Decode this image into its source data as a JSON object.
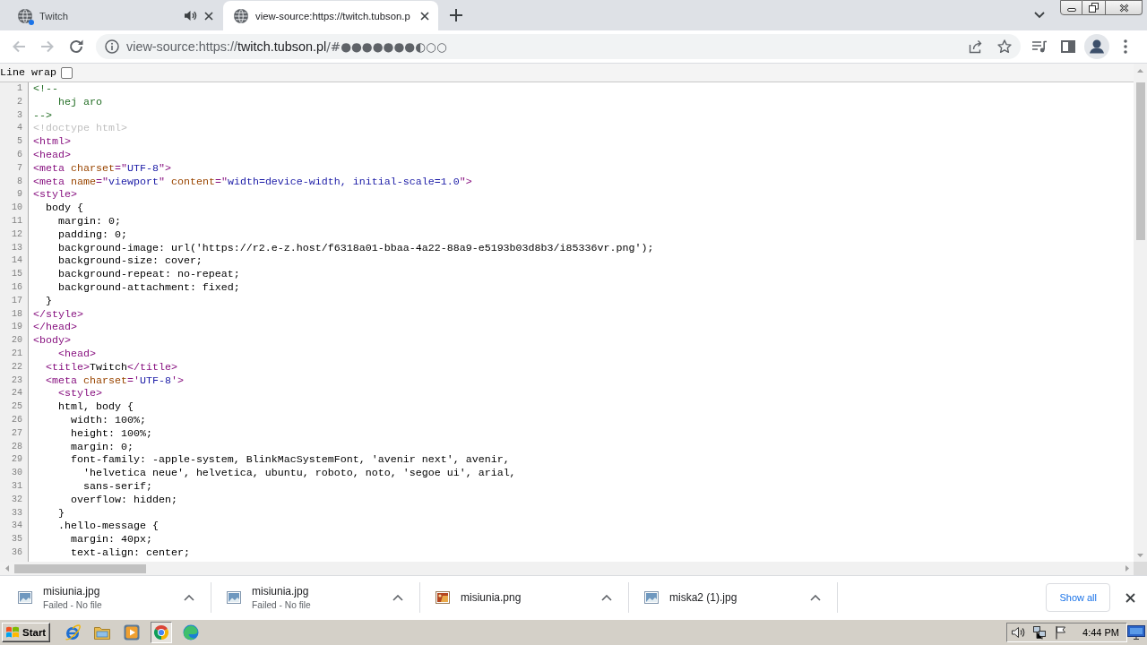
{
  "tabs": [
    {
      "title": "Twitch",
      "selected": false,
      "attention": true,
      "audio": true
    },
    {
      "title": "view-source:https://twitch.tubson.p",
      "selected": true,
      "attention": false,
      "audio": false
    }
  ],
  "toolbar": {
    "nav_buttons": [
      {
        "kind": "back",
        "disabled": true
      },
      {
        "kind": "forward",
        "disabled": true
      },
      {
        "kind": "reload",
        "disabled": false
      }
    ],
    "address": {
      "scheme": "view-source:https://",
      "host": "twitch.tubson.pl",
      "path": "/#●●●●●●●◐○○"
    }
  },
  "source_view": {
    "line_wrap": {
      "label": "Line wrap",
      "checked": false
    },
    "lines": [
      {
        "number": "1",
        "tokens": [
          {
            "kind": "comment",
            "text": "<!--"
          }
        ]
      },
      {
        "number": "2",
        "tokens": [
          {
            "kind": "comment",
            "text": "    hej aro"
          }
        ]
      },
      {
        "number": "3",
        "tokens": [
          {
            "kind": "comment",
            "text": "-->"
          }
        ]
      },
      {
        "number": "4",
        "tokens": [
          {
            "kind": "doctype",
            "text": "<!doctype html>"
          }
        ]
      },
      {
        "number": "5",
        "tokens": [
          {
            "kind": "tag",
            "text": "<html>"
          }
        ]
      },
      {
        "number": "6",
        "tokens": [
          {
            "kind": "tag",
            "text": "<head>"
          }
        ]
      },
      {
        "number": "7",
        "tokens": [
          {
            "kind": "tag",
            "text": "<meta "
          },
          {
            "kind": "attribute",
            "text": "charset"
          },
          {
            "kind": "tag",
            "text": "=\""
          },
          {
            "kind": "value",
            "text": "UTF-8"
          },
          {
            "kind": "tag",
            "text": "\">"
          }
        ]
      },
      {
        "number": "8",
        "tokens": [
          {
            "kind": "tag",
            "text": "<meta "
          },
          {
            "kind": "attribute",
            "text": "name"
          },
          {
            "kind": "tag",
            "text": "=\""
          },
          {
            "kind": "value",
            "text": "viewport"
          },
          {
            "kind": "tag",
            "text": "\" "
          },
          {
            "kind": "attribute",
            "text": "content"
          },
          {
            "kind": "tag",
            "text": "=\""
          },
          {
            "kind": "value",
            "text": "width=device-width, initial-scale=1.0"
          },
          {
            "kind": "tag",
            "text": "\">"
          }
        ]
      },
      {
        "number": "9",
        "tokens": [
          {
            "kind": "tag",
            "text": "<style>"
          }
        ]
      },
      {
        "number": "10",
        "tokens": [
          {
            "kind": "text",
            "text": "  body {"
          }
        ]
      },
      {
        "number": "11",
        "tokens": [
          {
            "kind": "text",
            "text": "    margin: 0;"
          }
        ]
      },
      {
        "number": "12",
        "tokens": [
          {
            "kind": "text",
            "text": "    padding: 0;"
          }
        ]
      },
      {
        "number": "13",
        "tokens": [
          {
            "kind": "text",
            "text": "    background-image: url('https://r2.e-z.host/f6318a01-bbaa-4a22-88a9-e5193b03d8b3/i85336vr.png');"
          }
        ]
      },
      {
        "number": "14",
        "tokens": [
          {
            "kind": "text",
            "text": "    background-size: cover;"
          }
        ]
      },
      {
        "number": "15",
        "tokens": [
          {
            "kind": "text",
            "text": "    background-repeat: no-repeat;"
          }
        ]
      },
      {
        "number": "16",
        "tokens": [
          {
            "kind": "text",
            "text": "    background-attachment: fixed;"
          }
        ]
      },
      {
        "number": "17",
        "tokens": [
          {
            "kind": "text",
            "text": "  }"
          }
        ]
      },
      {
        "number": "18",
        "tokens": [
          {
            "kind": "tag",
            "text": "</style>"
          }
        ]
      },
      {
        "number": "19",
        "tokens": [
          {
            "kind": "tag",
            "text": "</head>"
          }
        ]
      },
      {
        "number": "20",
        "tokens": [
          {
            "kind": "tag",
            "text": "<body>"
          }
        ]
      },
      {
        "number": "21",
        "tokens": [
          {
            "kind": "tag",
            "text": "    <head>"
          }
        ]
      },
      {
        "number": "22",
        "tokens": [
          {
            "kind": "tag",
            "text": "  <title>"
          },
          {
            "kind": "text",
            "text": "Twitch"
          },
          {
            "kind": "tag",
            "text": "</title>"
          }
        ]
      },
      {
        "number": "23",
        "tokens": [
          {
            "kind": "tag",
            "text": "  <meta "
          },
          {
            "kind": "attribute",
            "text": "charset"
          },
          {
            "kind": "tag",
            "text": "='"
          },
          {
            "kind": "value",
            "text": "UTF-8"
          },
          {
            "kind": "tag",
            "text": "'>"
          }
        ]
      },
      {
        "number": "24",
        "tokens": [
          {
            "kind": "tag",
            "text": "    <style>"
          }
        ]
      },
      {
        "number": "25",
        "tokens": [
          {
            "kind": "text",
            "text": "    html, body {"
          }
        ]
      },
      {
        "number": "26",
        "tokens": [
          {
            "kind": "text",
            "text": "      width: 100%;"
          }
        ]
      },
      {
        "number": "27",
        "tokens": [
          {
            "kind": "text",
            "text": "      height: 100%;"
          }
        ]
      },
      {
        "number": "28",
        "tokens": [
          {
            "kind": "text",
            "text": "      margin: 0;"
          }
        ]
      },
      {
        "number": "29",
        "tokens": [
          {
            "kind": "text",
            "text": "      font-family: -apple-system, BlinkMacSystemFont, 'avenir next', avenir,"
          }
        ]
      },
      {
        "number": "30",
        "tokens": [
          {
            "kind": "text",
            "text": "        'helvetica neue', helvetica, ubuntu, roboto, noto, 'segoe ui', arial,"
          }
        ]
      },
      {
        "number": "31",
        "tokens": [
          {
            "kind": "text",
            "text": "        sans-serif;"
          }
        ]
      },
      {
        "number": "32",
        "tokens": [
          {
            "kind": "text",
            "text": "      overflow: hidden;"
          }
        ]
      },
      {
        "number": "33",
        "tokens": [
          {
            "kind": "text",
            "text": "    }"
          }
        ]
      },
      {
        "number": "34",
        "tokens": [
          {
            "kind": "text",
            "text": "    .hello-message {"
          }
        ]
      },
      {
        "number": "35",
        "tokens": [
          {
            "kind": "text",
            "text": "      margin: 40px;"
          }
        ]
      },
      {
        "number": "36",
        "tokens": [
          {
            "kind": "text",
            "text": "      text-align: center;"
          }
        ]
      }
    ]
  },
  "downloads": {
    "items": [
      {
        "name": "misiunia.jpg",
        "status": "Failed - No file",
        "kind": "jpg"
      },
      {
        "name": "misiunia.jpg",
        "status": "Failed - No file",
        "kind": "jpg"
      },
      {
        "name": "misiunia.png",
        "kind": "png"
      },
      {
        "name": "miska2 (1).jpg",
        "kind": "jpg"
      }
    ],
    "show_all": "Show all"
  },
  "taskbar": {
    "start": "Start",
    "apps": [
      {
        "kind": "e-browser",
        "selected": false
      },
      {
        "kind": "folder",
        "selected": false
      },
      {
        "kind": "media-player",
        "selected": false
      },
      {
        "kind": "round-browser",
        "selected": true
      },
      {
        "kind": "wave-browser",
        "selected": false
      }
    ],
    "clock": "4:44 PM"
  }
}
